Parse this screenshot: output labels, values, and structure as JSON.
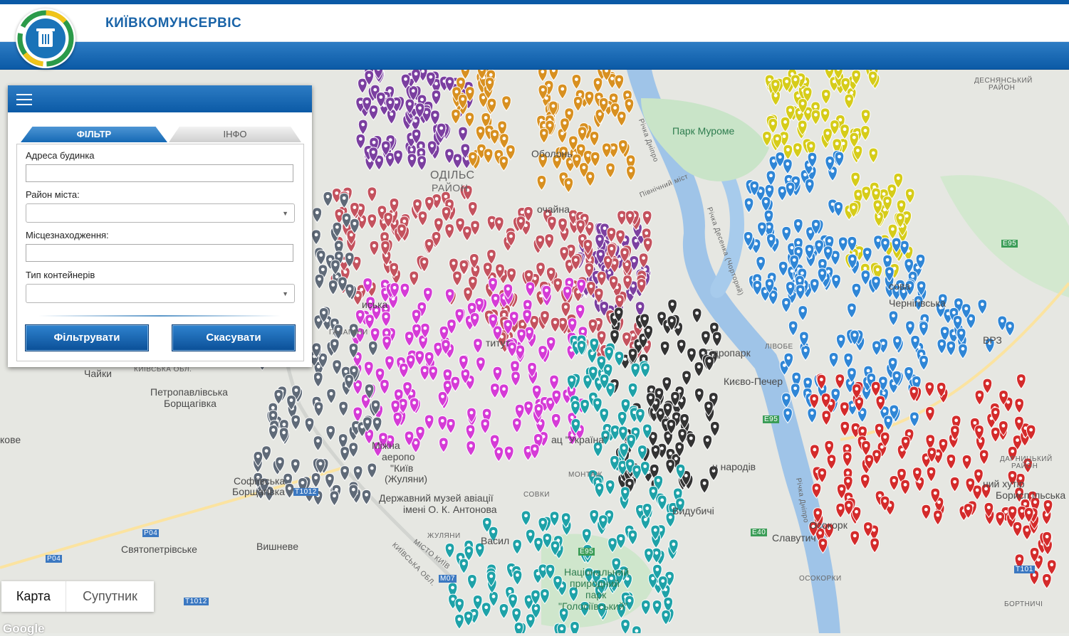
{
  "header": {
    "brand": "КИЇВКОМУНСЕРВІС"
  },
  "panel": {
    "tabs": {
      "filter": "ФІЛЬТР",
      "info": "ІНФО"
    },
    "fields": {
      "address_label": "Адреса будинка",
      "address_value": "",
      "district_label": "Район міста:",
      "district_value": "",
      "location_label": "Місцезнаходження:",
      "location_value": "",
      "type_label": "Тип контейнерів",
      "type_value": ""
    },
    "buttons": {
      "filter": "Фільтрувати",
      "cancel": "Скасувати"
    }
  },
  "maptype": {
    "map": "Карта",
    "satellite": "Супутник"
  },
  "attribution": "Google",
  "map_labels": {
    "park_muromets": "Парк Муроме",
    "obolon": "Оболонь",
    "pochaina": "очайна",
    "podilskyi": "ОДІЛЬС",
    "rayon": "РАЙОН",
    "desnianskyi_1": "ДЕСНЯНСЬКИЙ",
    "desnianskyi_2": "РАЙОН",
    "hidropark": "Гідропарк",
    "kyievo_pechersk": "Києво-Печер",
    "chaiky": "Чайки",
    "kyivska_obl": "КИЇВСЬКА ОБЛ.",
    "petropavlivska_1": "Петропавлівська",
    "petropavlivska_2": "Борщагівка",
    "kovo": "кове",
    "sofiivska_1": "Софіївська",
    "sofiivska_2": "Борщагівка",
    "t1012": "T1012",
    "p04_1": "P04",
    "p04_2": "P04",
    "sviatopetrivske": "Святопетрівське",
    "vyshneve": "Вишневе",
    "zhuliany_1": "Міжна",
    "zhuliany_2": "аеропо",
    "zhuliany_3": "\"Київ",
    "zhuliany_4": "(Жуляни)",
    "museum_1": "Державний музей авіації",
    "museum_2": "імені О. К. Антонова",
    "sovky": "СОВКИ",
    "vasyl": "Васил",
    "zhuliany": "ЖУЛЯНИ",
    "misto_kyiv": "МІСТО КИЇВ",
    "kyivska_obl_2": "КИЇВСЬКА ОБЛ.",
    "m07": "M07",
    "e95": "E95",
    "e95_2": "E95",
    "e40": "E40",
    "e95_3": "E95",
    "t1012_2": "T1012",
    "t1012_3": "T101",
    "park_holosiiv_1": "Національний",
    "park_holosiiv_2": "природний",
    "park_holosiiv_3": "парк",
    "park_holosiiv_4": "\"Голосіївський\"",
    "vydubychi": "Видубичі",
    "narodiv": "н народів",
    "slavutych": "Славутич",
    "osokorky_1": "Осокорк",
    "osokorky_2": "ОСОКОРКИ",
    "bortnychi": "БОРТНИЧІ",
    "boryspilska": "Борисп ільська",
    "khutir": "ний хутір",
    "darnytskyi_1": "ДАРНИЦЬКИЙ",
    "darnytskyi_2": "РАЙОН",
    "chernihivska": "Чернігівська",
    "lisova": "сова",
    "vrz": "ВРЗ",
    "livobe": "ЛІВОБЕ",
    "pivnichnyi_mist": "Північний міст",
    "desna_river": "Річка Десенка (Чорторий)",
    "dnipro_river": "Річка Дніпро",
    "dnipro_river_2": "Річка Дніпро",
    "halahany": "ГАЛАГАНИ",
    "dvorets": "ац \"Україна\"",
    "montazh": "МОНТАЖ",
    "instytut": "титут",
    "isska": "иська"
  }
}
